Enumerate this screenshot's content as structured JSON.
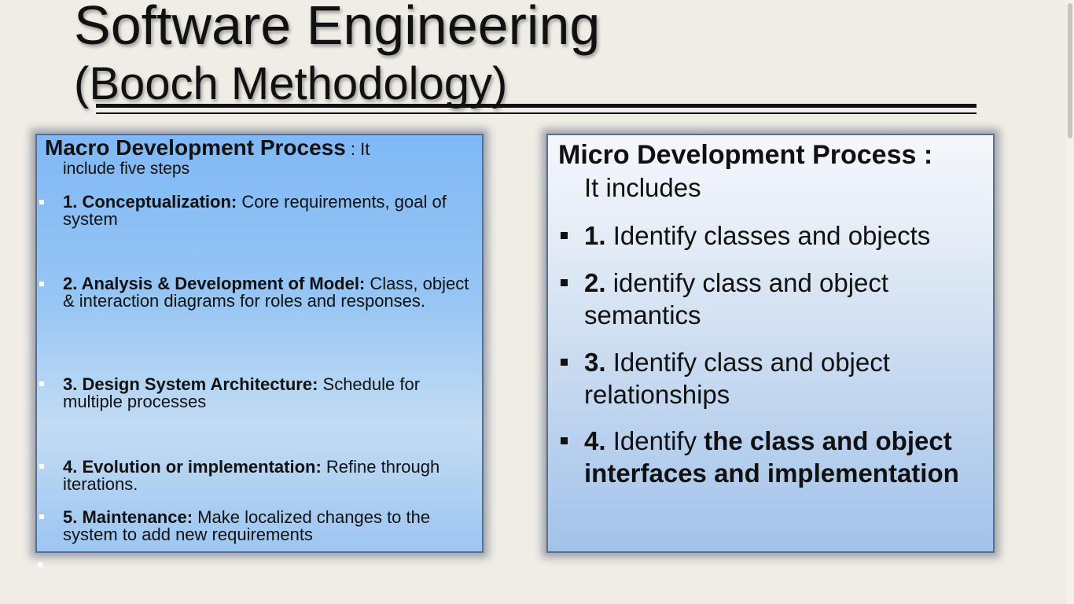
{
  "slide": {
    "title": "Software Engineering",
    "subtitle": "(Booch Methodology)"
  },
  "macro": {
    "heading": "Macro Development Process",
    "heading_tail": " :  It",
    "intro": "include five steps",
    "items": [
      {
        "label": " 1. Conceptualization:",
        "text": " Core requirements, goal of system"
      },
      {
        "label": " 2.  Analysis & Development of  Model:",
        "text": " Class, object & interaction diagrams  for roles and responses."
      },
      {
        "label": "3.  Design System Architecture:",
        "text": " Schedule for multiple  processes"
      },
      {
        "label": "4.  Evolution or implementation:",
        "text": " Refine through iterations."
      },
      {
        "label": "5.  Maintenance:",
        "text": " Make localized changes to the system  to add new requirements"
      }
    ]
  },
  "micro": {
    "heading": "Micro Development Process :",
    "intro": "It includes",
    "items": [
      {
        "num": "1.",
        "text": " Identify classes and objects",
        "bold_text": ""
      },
      {
        "num": "2.",
        "text": " identify class and object semantics",
        "bold_text": ""
      },
      {
        "num": " 3.",
        "text": " Identify class and object relationships",
        "bold_text": ""
      },
      {
        "num": "4.",
        "text": " Identify ",
        "bold_text": "the class and object interfaces and implementation"
      }
    ]
  }
}
